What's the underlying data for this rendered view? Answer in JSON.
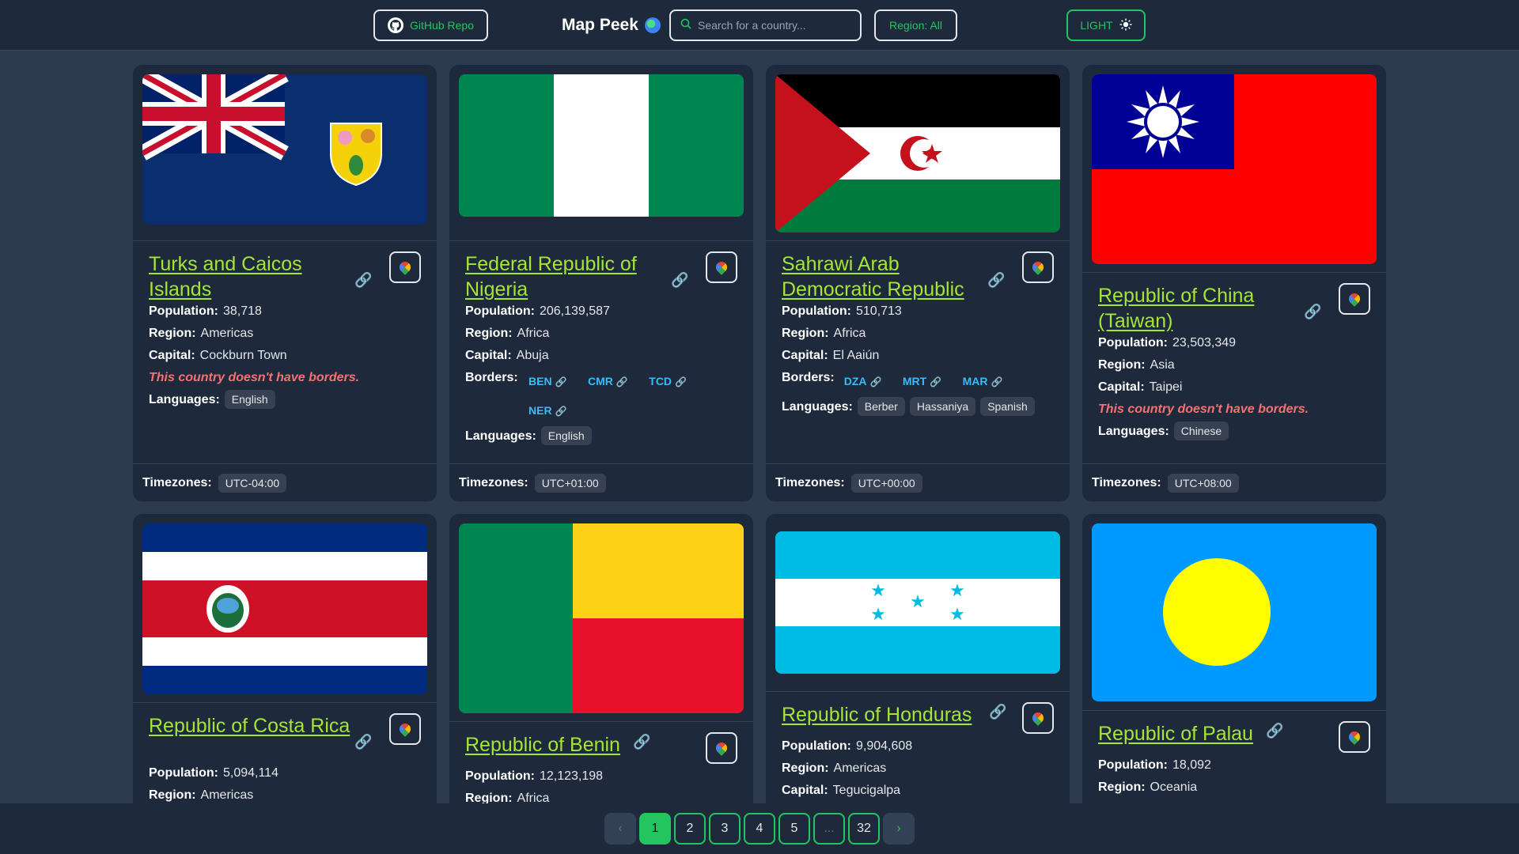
{
  "header": {
    "github_label": "GitHub Repo",
    "brand_title": "Map Peek",
    "search_placeholder": "Search for a country...",
    "region_label": "Region: All",
    "theme_label": "LIGHT"
  },
  "labels": {
    "population": "Population:",
    "region": "Region:",
    "capital": "Capital:",
    "borders": "Borders:",
    "languages": "Languages:",
    "timezones": "Timezones:",
    "no_borders": "This country doesn't have borders."
  },
  "cards": [
    {
      "name": "Turks and Caicos Islands",
      "population": "38,718",
      "region": "Americas",
      "capital": "Cockburn Town",
      "languages": [
        "English"
      ],
      "timezone": "UTC-04:00"
    },
    {
      "name": "Federal Republic of Nigeria",
      "population": "206,139,587",
      "region": "Africa",
      "capital": "Abuja",
      "borders": [
        "BEN",
        "CMR",
        "TCD",
        "NER"
      ],
      "languages": [
        "English"
      ],
      "timezone": "UTC+01:00"
    },
    {
      "name": "Sahrawi Arab Democratic Republic",
      "population": "510,713",
      "region": "Africa",
      "capital": "El Aaiún",
      "borders": [
        "DZA",
        "MRT",
        "MAR"
      ],
      "languages": [
        "Berber",
        "Hassaniya",
        "Spanish"
      ],
      "timezone": "UTC+00:00"
    },
    {
      "name": "Republic of China (Taiwan)",
      "population": "23,503,349",
      "region": "Asia",
      "capital": "Taipei",
      "languages": [
        "Chinese"
      ],
      "timezone": "UTC+08:00"
    },
    {
      "name": "Republic of Costa Rica",
      "population": "5,094,114",
      "region": "Americas"
    },
    {
      "name": "Republic of Benin",
      "population": "12,123,198",
      "region": "Africa"
    },
    {
      "name": "Republic of Honduras",
      "population": "9,904,608",
      "region": "Americas",
      "capital": "Tegucigalpa"
    },
    {
      "name": "Republic of Palau",
      "population": "18,092",
      "region": "Oceania"
    }
  ],
  "pagination": {
    "prev": "‹",
    "next": "›",
    "pages": [
      "1",
      "2",
      "3",
      "4",
      "5",
      "...",
      "32"
    ],
    "current": "1"
  },
  "colors": {
    "accent": "#22c55e",
    "name": "#a3e635",
    "warning": "#f87171",
    "border_code": "#38bdf8"
  }
}
